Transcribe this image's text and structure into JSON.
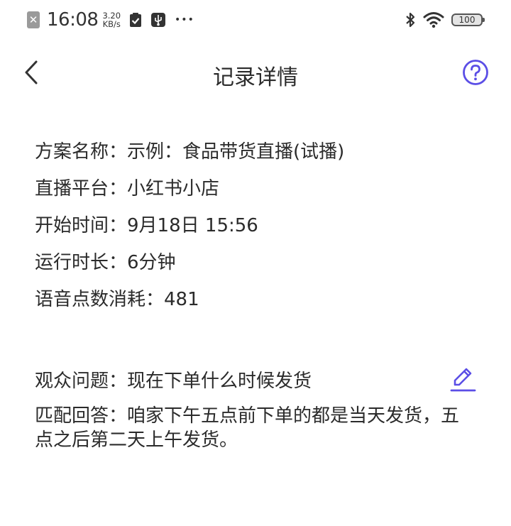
{
  "status_bar": {
    "sim_glyph": "✕",
    "time": "16:08",
    "net_speed_value": "3.20",
    "net_speed_unit": "KB/s",
    "more_glyph": "•••",
    "battery_level": "100",
    "icons": [
      "sim-off-icon",
      "clipboard-check-icon",
      "usb-icon",
      "more-dots-icon",
      "bluetooth-icon",
      "wifi-icon",
      "battery-icon"
    ]
  },
  "nav": {
    "title": "记录详情",
    "icons": [
      "chevron-left-icon",
      "help-circle-icon"
    ],
    "accent_color": "#5b4ee6"
  },
  "details": [
    {
      "label": "方案名称：",
      "value": "示例：食品带货直播(试播)"
    },
    {
      "label": "直播平台：",
      "value": "小红书小店"
    },
    {
      "label": "开始时间：",
      "value": "9月18日 15:56"
    },
    {
      "label": "运行时长：",
      "value": "6分钟"
    },
    {
      "label": "语音点数消耗：",
      "value": "481"
    }
  ],
  "qa": {
    "question_label": "观众问题：",
    "question": "现在下单什么时候发货",
    "answer_label": "匹配回答：",
    "answer": "咱家下午五点前下单的都是当天发货，五点之后第二天上午发货。",
    "edit_icon": "edit-pencil-icon"
  }
}
